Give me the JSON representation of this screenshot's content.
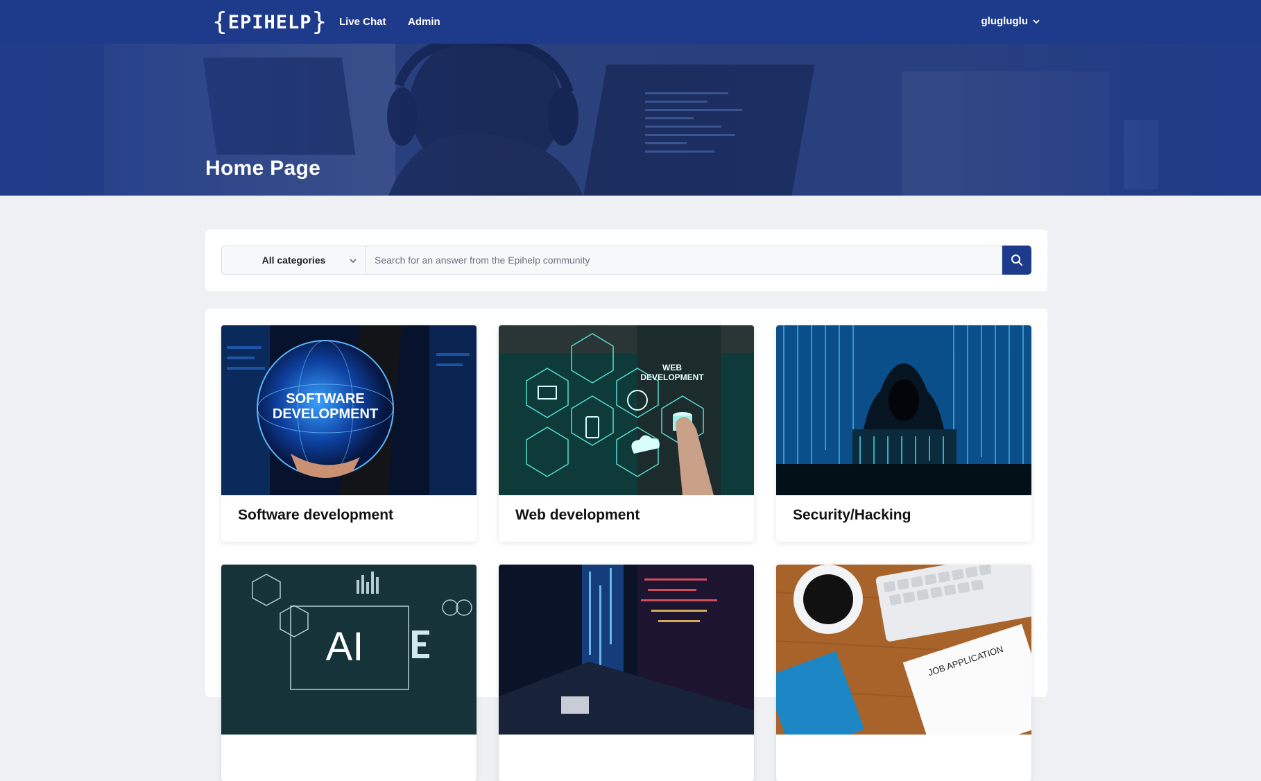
{
  "nav": {
    "logo_text": "EPIHELP",
    "links": [
      "Live Chat",
      "Admin"
    ],
    "user": "glugluglu"
  },
  "hero": {
    "title": "Home Page"
  },
  "search": {
    "category_selected": "All categories",
    "placeholder": "Search for an answer from the Epihelp community"
  },
  "categories": [
    {
      "title": "Software development",
      "image_text": [
        "SOFTWARE",
        "DEVELOPMENT"
      ]
    },
    {
      "title": "Web development",
      "image_text": [
        "WEB",
        "DEVELOPMENT"
      ]
    },
    {
      "title": "Security/Hacking"
    },
    {
      "title": "",
      "image_text": [
        "AI"
      ]
    },
    {
      "title": ""
    },
    {
      "title": "",
      "image_text": [
        "JOB APPLICATION"
      ]
    }
  ],
  "colors": {
    "brand": "#1e3a8a",
    "page_bg": "#eef0f4"
  }
}
